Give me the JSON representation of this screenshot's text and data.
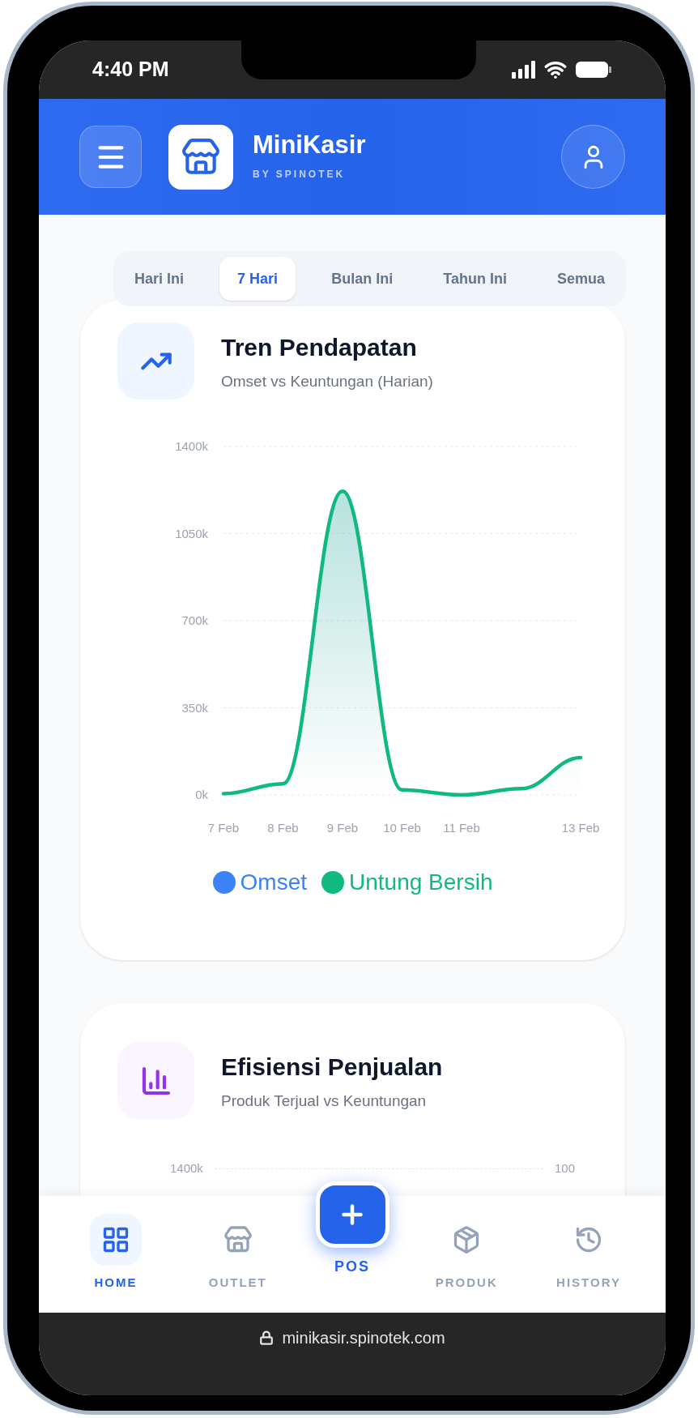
{
  "status_bar": {
    "time": "4:40 PM"
  },
  "header": {
    "title": "MiniKasir",
    "subtitle": "BY SPINOTEK"
  },
  "period_tabs": [
    {
      "label": "Hari Ini",
      "selected": false
    },
    {
      "label": "7 Hari",
      "selected": true
    },
    {
      "label": "Bulan Ini",
      "selected": false
    },
    {
      "label": "Tahun Ini",
      "selected": false
    },
    {
      "label": "Semua",
      "selected": false
    }
  ],
  "revenue_card": {
    "title": "Tren Pendapatan",
    "subtitle": "Omset vs Keuntungan (Harian)",
    "chart_data": {
      "type": "area",
      "categories": [
        "7 Feb",
        "8 Feb",
        "9 Feb",
        "10 Feb",
        "11 Feb",
        null,
        "13 Feb"
      ],
      "grid": true,
      "series": [
        {
          "name": "Omset",
          "color": "#3b82f6",
          "values": [
            null,
            null,
            null,
            null,
            null,
            null,
            null
          ]
        },
        {
          "name": "Untung Bersih",
          "color": "#10b981",
          "values": [
            5,
            45,
            1220,
            20,
            0,
            25,
            150
          ]
        }
      ],
      "ylim": [
        0,
        1400
      ],
      "yticks": [
        {
          "value": 0,
          "label": "0k"
        },
        {
          "value": 350,
          "label": "350k"
        },
        {
          "value": 700,
          "label": "700k"
        },
        {
          "value": 1050,
          "label": "1050k"
        },
        {
          "value": 1400,
          "label": "1400k"
        }
      ]
    }
  },
  "efficiency_card": {
    "title": "Efisiensi Penjualan",
    "subtitle": "Produk Terjual vs Keuntungan",
    "left_tick": "1400k",
    "right_tick": "100"
  },
  "bottom_nav": [
    {
      "label": "HOME",
      "selected": true,
      "kind": "tab"
    },
    {
      "label": "OUTLET",
      "selected": false,
      "kind": "tab"
    },
    {
      "label": "POS",
      "kind": "action"
    },
    {
      "label": "PRODUK",
      "selected": false,
      "kind": "tab"
    },
    {
      "label": "HISTORY",
      "selected": false,
      "kind": "tab"
    }
  ],
  "address_bar": {
    "url": "minikasir.spinotek.com"
  }
}
